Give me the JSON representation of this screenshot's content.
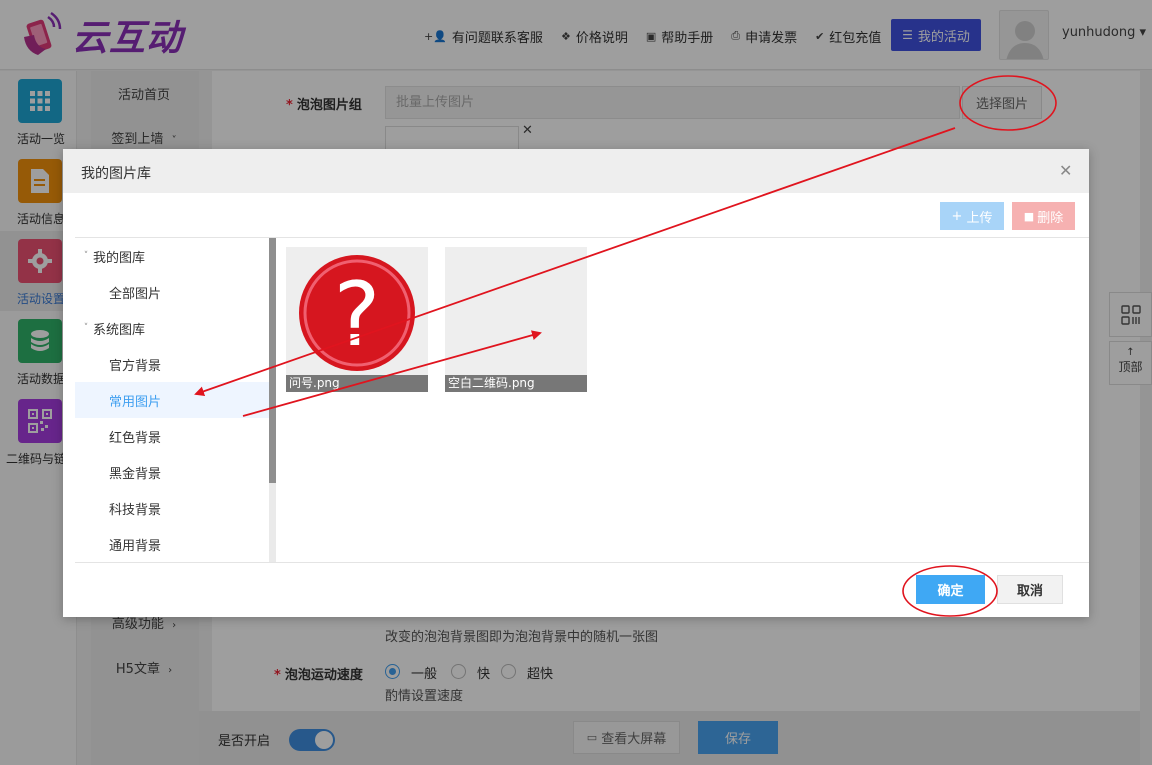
{
  "header": {
    "logo_text": "云互动",
    "nav": [
      {
        "icon": "user-plus-icon",
        "label": "有问题联系客服"
      },
      {
        "icon": "yen-icon",
        "label": "价格说明"
      },
      {
        "icon": "book-icon",
        "label": "帮助手册"
      },
      {
        "icon": "printer-icon",
        "label": "申请发票"
      },
      {
        "icon": "shield-icon",
        "label": "红包充值"
      }
    ],
    "my_activity": "我的活动",
    "username": "yunhudong"
  },
  "sidebar": {
    "items": [
      {
        "label": "活动一览",
        "color": "#1da7d6",
        "icon": "grid-icon"
      },
      {
        "label": "活动信息",
        "color": "#f2920c",
        "icon": "document-icon"
      },
      {
        "label": "活动设置",
        "color": "#ee5273",
        "icon": "gear-icon",
        "active": true
      },
      {
        "label": "活动数据",
        "color": "#2fb36a",
        "icon": "database-icon"
      },
      {
        "label": "二维码与链",
        "color": "#a63ce0",
        "icon": "qrcode-icon"
      }
    ]
  },
  "subnav": {
    "items": [
      "活动首页",
      "签到上墙",
      "高级功能",
      "H5文章"
    ]
  },
  "form": {
    "bubble_group_label": "泡泡图片组",
    "upload_placeholder": "批量上传图片",
    "choose_button": "选择图片",
    "random_hint": "改变的泡泡背景图即为泡泡背景中的随机一张图",
    "speed_label": "泡泡运动速度",
    "speed_options": [
      "一般",
      "快",
      "超快"
    ],
    "speed_selected": "一般",
    "speed_hint": "酌情设置速度"
  },
  "bottombar": {
    "switch_label": "是否开启",
    "switch_on": true,
    "view_screen": "查看大屏幕",
    "save": "保存"
  },
  "float_tools": {
    "top_label": "顶部"
  },
  "modal": {
    "title": "我的图片库",
    "upload_button": "上传",
    "delete_button": "删除",
    "tree": [
      {
        "label": "我的图库",
        "level": 0,
        "expanded": true
      },
      {
        "label": "全部图片",
        "level": 1
      },
      {
        "label": "系统图库",
        "level": 0,
        "expanded": true
      },
      {
        "label": "官方背景",
        "level": 1
      },
      {
        "label": "常用图片",
        "level": 1,
        "selected": true
      },
      {
        "label": "红色背景",
        "level": 1
      },
      {
        "label": "黑金背景",
        "level": 1
      },
      {
        "label": "科技背景",
        "level": 1
      },
      {
        "label": "通用背景",
        "level": 1
      }
    ],
    "images": [
      {
        "name": "问号.png",
        "icon": "question-mark-icon"
      },
      {
        "name": "空白二维码.png",
        "icon": "blank-qrcode-image"
      }
    ],
    "ok_button": "确定",
    "cancel_button": "取消"
  },
  "colors": {
    "primary": "#3f51e0",
    "accent_blue": "#3fa8f4",
    "annotation_red": "#e0141e"
  }
}
